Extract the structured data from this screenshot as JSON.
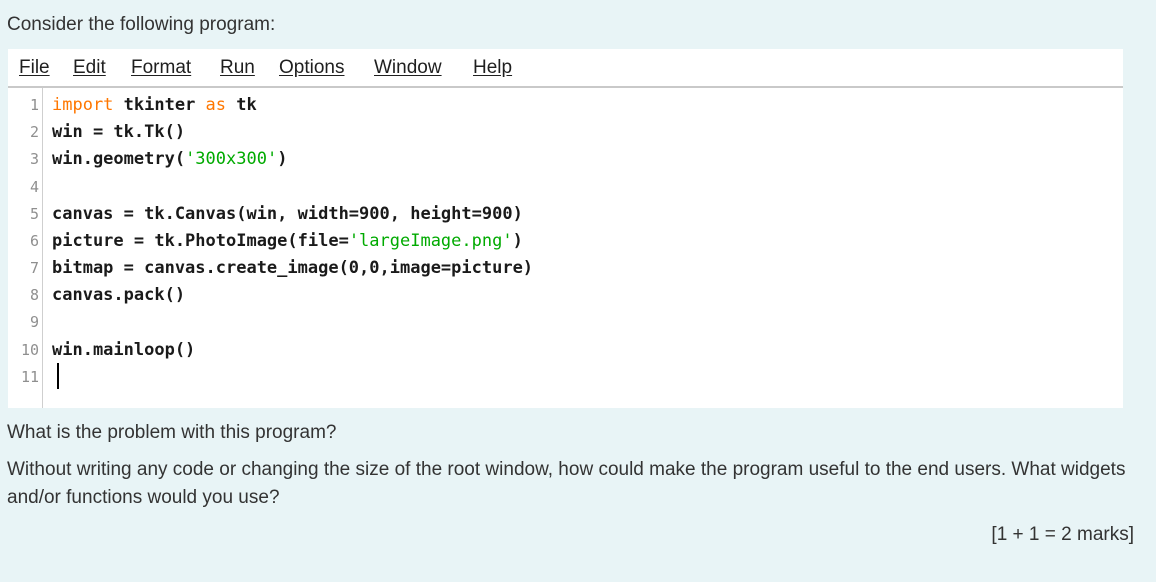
{
  "intro": "Consider the following program:",
  "menu": [
    "File",
    "Edit",
    "Format",
    "Run",
    "Options",
    "Window",
    "Help"
  ],
  "line_numbers": [
    "1",
    "2",
    "3",
    "4",
    "5",
    "6",
    "7",
    "8",
    "9",
    "10",
    "11"
  ],
  "code": {
    "l1_kw1": "import",
    "l1_mid": " tkinter ",
    "l1_kw2": "as",
    "l1_end": " tk",
    "l2": "win = tk.Tk()",
    "l3_pre": "win.geometry(",
    "l3_str": "'300x300'",
    "l3_post": ")",
    "l5": "canvas = tk.Canvas(win, width=900, height=900)",
    "l6_pre": "picture = tk.PhotoImage(file=",
    "l6_str": "'largeImage.png'",
    "l6_post": ")",
    "l7": "bitmap = canvas.create_image(0,0,image=picture)",
    "l8": "canvas.pack()",
    "l10": "win.mainloop()"
  },
  "question1": "What is the problem with this program?",
  "question2": "Without writing any code or changing the size of the root window, how could make the program useful to the end users.  What widgets and/or functions would you use?",
  "marks": "[1 + 1 = 2 marks]",
  "colors": {
    "page_bg": "#e8f4f6",
    "keyword": "#ff7700",
    "string": "#00aa00"
  }
}
